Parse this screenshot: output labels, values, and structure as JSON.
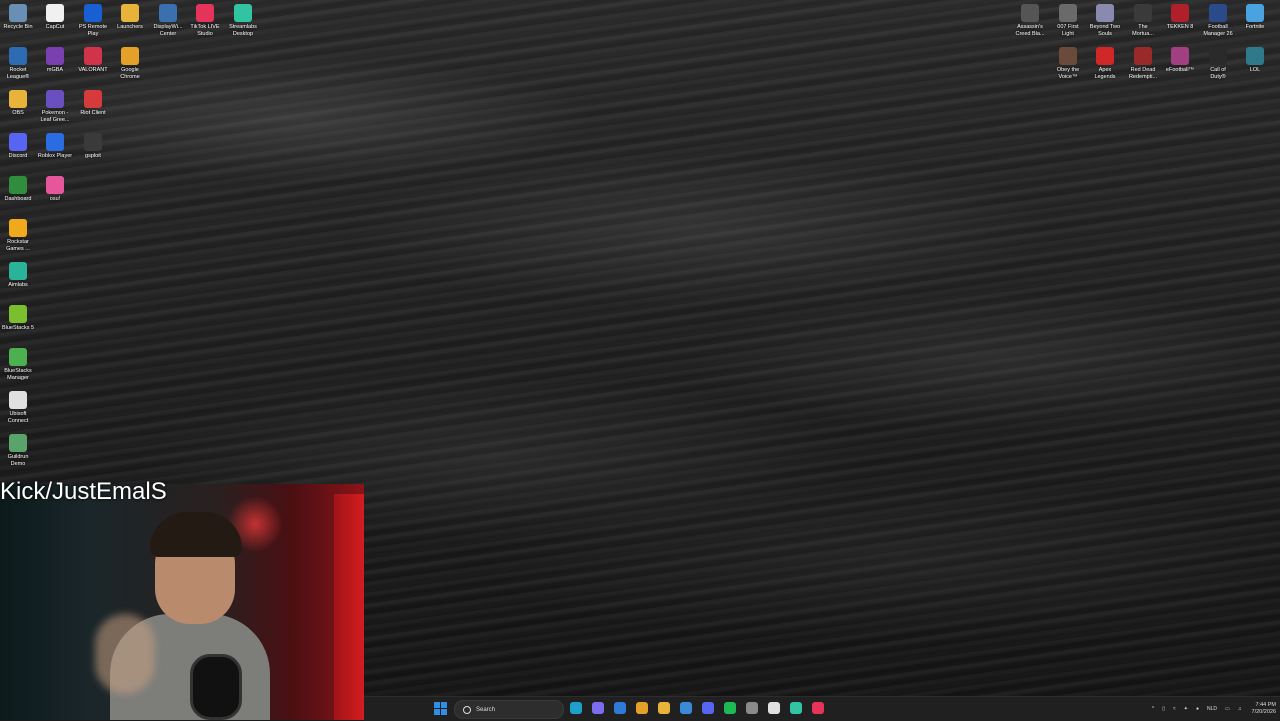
{
  "desktop": {
    "left_icons": [
      {
        "label": "Recycle Bin",
        "icon": "recycle-bin-icon",
        "color": "#6a8fb5"
      },
      {
        "label": "CapCut",
        "icon": "capcut-icon",
        "color": "#f0f0f0"
      },
      {
        "label": "PS Remote\nPlay",
        "icon": "ps-remote-play-icon",
        "color": "#1a5fd1"
      },
      {
        "label": "Launchers",
        "icon": "folder-icon",
        "color": "#e8b33a"
      },
      {
        "label": "DisplayWi...\nCenter",
        "icon": "display-icon",
        "color": "#3a6fb0"
      },
      {
        "label": "TikTok LIVE\nStudio",
        "icon": "tiktok-icon",
        "color": "#e6335a"
      },
      {
        "label": "Streamlabs\nDesktop",
        "icon": "streamlabs-icon",
        "color": "#31c3a2"
      },
      {
        "label": "Rocket\nLeague®",
        "icon": "rocket-league-icon",
        "color": "#2d6bb3"
      },
      {
        "label": "mGBA",
        "icon": "mgba-icon",
        "color": "#7a3fb0"
      },
      {
        "label": "VALORANT",
        "icon": "valorant-icon",
        "color": "#d1344a"
      },
      {
        "label": "Google\nChrome",
        "icon": "chrome-icon",
        "color": "#e3a12a"
      },
      {
        "label": "OBS",
        "icon": "folder-icon",
        "color": "#e8b33a"
      },
      {
        "label": "Pokemon -\nLeaf Gree...",
        "icon": "pokemon-icon",
        "color": "#6a4fc0"
      },
      {
        "label": "Riot Client",
        "icon": "riot-client-icon",
        "color": "#d63b3b"
      },
      {
        "label": "Discord",
        "icon": "discord-icon",
        "color": "#5865f2"
      },
      {
        "label": "Roblox Player",
        "icon": "roblox-icon",
        "color": "#2b6de0"
      },
      {
        "label": "gsploit",
        "icon": "gsploit-icon",
        "color": "#3a3a3a"
      },
      {
        "label": "Dashboard",
        "icon": "dashboard-icon",
        "color": "#2f8d3d"
      },
      {
        "label": "osu!",
        "icon": "osu-icon",
        "color": "#e5579a"
      },
      {
        "label": "Rockstar\nGames ...",
        "icon": "rockstar-icon",
        "color": "#f0a81c"
      },
      {
        "label": "Aimlabs",
        "icon": "aimlabs-icon",
        "color": "#2bb39a"
      },
      {
        "label": "BlueStacks 5",
        "icon": "bluestacks-icon",
        "color": "#7cbf2e"
      },
      {
        "label": "BlueStacks\nManager",
        "icon": "bluestacks-manager-icon",
        "color": "#4caf50"
      },
      {
        "label": "Ubisoft\nConnect",
        "icon": "ubisoft-icon",
        "color": "#e0e0e0"
      },
      {
        "label": "Guildrun\nDemo",
        "icon": "guildrun-icon",
        "color": "#5aa36a"
      }
    ],
    "right_icons": [
      {
        "label": "Assassin's\nCreed Bla...",
        "icon": "assassins-creed-icon",
        "color": "#555555"
      },
      {
        "label": "007 First\nLight",
        "icon": "007-icon",
        "color": "#6a6a6a"
      },
      {
        "label": "Beyond Two\nSouls",
        "icon": "beyond-two-souls-icon",
        "color": "#8a8ab0"
      },
      {
        "label": "The\nMortua...",
        "icon": "mortuary-icon",
        "color": "#3a3a3a"
      },
      {
        "label": "TEKKEN 8",
        "icon": "tekken-icon",
        "color": "#b0202a"
      },
      {
        "label": "Football\nManager 26",
        "icon": "football-manager-icon",
        "color": "#2a4a8a"
      },
      {
        "label": "Fortnite",
        "icon": "fortnite-icon",
        "color": "#4aa3e0"
      },
      {
        "label": "Obey the\nVoice™",
        "icon": "obey-voice-icon",
        "color": "#6a4a3a"
      },
      {
        "label": "Apex\nLegends",
        "icon": "apex-icon",
        "color": "#d02828"
      },
      {
        "label": "Red Dead\nRedempti...",
        "icon": "red-dead-icon",
        "color": "#9a2a2a"
      },
      {
        "label": "eFootball™",
        "icon": "efootball-icon",
        "color": "#a04080"
      },
      {
        "label": "Call of\nDuty®",
        "icon": "call-of-duty-icon",
        "color": "#2a2a2a"
      },
      {
        "label": "LOL",
        "icon": "lol-icon",
        "color": "#2f7a8a"
      }
    ]
  },
  "stream_overlay": {
    "title": "Kick/JustEmalS"
  },
  "taskbar": {
    "search_placeholder": "Search",
    "apps": [
      {
        "icon": "edge-icon",
        "color": "#1ea0c9"
      },
      {
        "icon": "copilot-icon",
        "color": "#7b6cf0"
      },
      {
        "icon": "mail-icon",
        "color": "#2f7ad8"
      },
      {
        "icon": "chrome-icon",
        "color": "#e3a12a"
      },
      {
        "icon": "file-explorer-icon",
        "color": "#e8b33a"
      },
      {
        "icon": "photos-icon",
        "color": "#3a8ad8"
      },
      {
        "icon": "discord-icon",
        "color": "#5865f2"
      },
      {
        "icon": "spotify-icon",
        "color": "#1db954"
      },
      {
        "icon": "settings-icon",
        "color": "#8a8a8a"
      },
      {
        "icon": "capcut-icon",
        "color": "#e0e0e0"
      },
      {
        "icon": "streamlabs-icon",
        "color": "#31c3a2"
      },
      {
        "icon": "tiktok-live-icon",
        "color": "#e6335a"
      }
    ],
    "tray": {
      "language": "NLD",
      "time": "7:44 PM",
      "date": "7/20/2026"
    }
  }
}
